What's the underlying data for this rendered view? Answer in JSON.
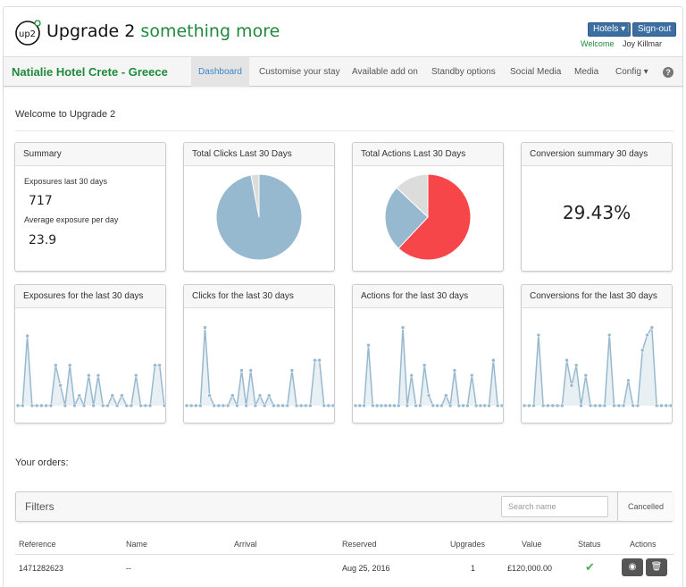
{
  "app": {
    "brand_main": "Upgrade 2",
    "brand_accent": "something more",
    "logo_text": "up2",
    "hotels_button": "Hotels ▾",
    "signout_button": "Sign-out",
    "separator": "|",
    "welcome": "Welcome",
    "user_name": "Joy Killmar"
  },
  "nav": {
    "hotel_name": "Natialie Hotel Crete - Greece",
    "items": [
      "Dashboard",
      "Customise your stay",
      "Available add on",
      "Standby options",
      "Social Media",
      "Media",
      "Config ▾"
    ],
    "active": "Dashboard",
    "help_icon": "?"
  },
  "page": {
    "title": "Welcome to Upgrade 2"
  },
  "summary": {
    "title": "Summary",
    "exposures_label": "Exposures last 30 days",
    "exposures_value": "717",
    "avg_label": "Average exposure per day",
    "avg_value": "23.9"
  },
  "clicks_panel": {
    "title": "Total Clicks Last 30 Days"
  },
  "actions_panel": {
    "title": "Total Actions Last 30 Days"
  },
  "conversion_panel": {
    "title": "Conversion summary 30 days",
    "value": "29.43%"
  },
  "spark_panels": {
    "exposures": "Exposures for the last 30 days",
    "clicks": "Clicks for the last 30 days",
    "actions": "Actions for the last 30 days",
    "conversions": "Conversions for the last 30 days"
  },
  "colors": {
    "blue": "#97b9cf",
    "red": "#f7464a",
    "grey": "#dcdcdc",
    "green": "#1f8a3b"
  },
  "chart_data": [
    {
      "type": "pie",
      "panel": "Total Clicks Last 30 Days",
      "series": [
        {
          "values": [
            0.97,
            0.03
          ],
          "colors": [
            "#97b9cf",
            "#dcdcdc"
          ]
        }
      ]
    },
    {
      "type": "pie",
      "panel": "Total Actions Last 30 Days",
      "series": [
        {
          "values": [
            0.62,
            0.25,
            0.13
          ],
          "colors": [
            "#f7464a",
            "#97b9cf",
            "#dcdcdc"
          ]
        }
      ]
    },
    {
      "type": "area",
      "panel": "Exposures for the last 30 days",
      "ylim": [
        0,
        1
      ],
      "values": [
        0,
        0,
        0.83,
        0,
        0,
        0,
        0,
        0,
        0.48,
        0.24,
        0,
        0.48,
        0,
        0.12,
        0,
        0.36,
        0,
        0.36,
        0,
        0,
        0.12,
        0,
        0.12,
        0,
        0,
        0.36,
        0,
        0,
        0,
        0.48,
        0.48,
        0
      ]
    },
    {
      "type": "area",
      "panel": "Clicks for the last 30 days",
      "ylim": [
        0,
        1
      ],
      "values": [
        0,
        0,
        0,
        0,
        0.93,
        0.12,
        0,
        0,
        0,
        0,
        0.12,
        0,
        0.42,
        0,
        0.42,
        0,
        0.12,
        0,
        0.12,
        0,
        0,
        0,
        0,
        0.42,
        0,
        0,
        0,
        0,
        0.54,
        0.54,
        0,
        0,
        0
      ]
    },
    {
      "type": "area",
      "panel": "Actions for the last 30 days",
      "ylim": [
        0,
        1
      ],
      "values": [
        0,
        0,
        0,
        0.72,
        0,
        0,
        0,
        0,
        0,
        0,
        0,
        0.93,
        0,
        0.36,
        0,
        0,
        0.48,
        0.12,
        0,
        0,
        0,
        0.12,
        0,
        0.42,
        0,
        0,
        0,
        0.36,
        0,
        0,
        0,
        0,
        0.54,
        0,
        0
      ]
    },
    {
      "type": "area",
      "panel": "Conversions for the last 30 days",
      "ylim": [
        0,
        1
      ],
      "values": [
        0,
        0,
        0,
        0.84,
        0,
        0,
        0,
        0,
        0,
        0.54,
        0.24,
        0.48,
        0,
        0.36,
        0,
        0,
        0,
        0,
        0.84,
        0,
        0,
        0,
        0.3,
        0,
        0,
        0.66,
        0.84,
        0.93,
        0,
        0,
        0,
        0
      ]
    }
  ],
  "orders": {
    "title": "Your orders:",
    "filters_label": "Filters",
    "search_placeholder": "Search name",
    "cancelled_button": "Cancelled",
    "columns": [
      "Reference",
      "Name",
      "Arrival",
      "Reserved",
      "Upgrades",
      "Value",
      "Status",
      "Actions"
    ],
    "rows": [
      {
        "reference": "1471282623",
        "name": "--",
        "arrival": "",
        "reserved": "Aug 25, 2016",
        "upgrades": "1",
        "value": "£120,000.00",
        "status": "check-icon"
      }
    ]
  }
}
